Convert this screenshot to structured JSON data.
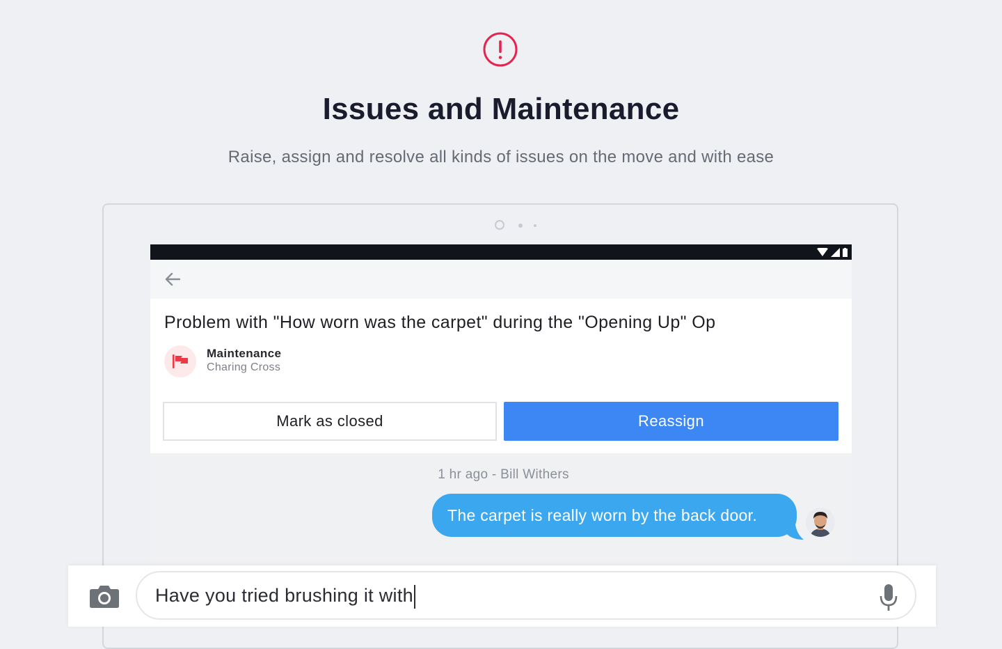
{
  "hero": {
    "title": "Issues and Maintenance",
    "subtitle": "Raise, assign and resolve all kinds of issues on the move and with ease",
    "icon": "alert-circle-icon",
    "accent_color": "#e5244f"
  },
  "issue": {
    "title": "Problem with \"How worn was the carpet\" during the \"Opening Up\" Op",
    "category": "Maintenance",
    "location": "Charing Cross",
    "icon": "flag-icon",
    "icon_color": "#ea3a45"
  },
  "actions": {
    "close_label": "Mark as closed",
    "reassign_label": "Reassign",
    "primary_color": "#3d87f5"
  },
  "conversation": {
    "meta": "1 hr ago - Bill Withers",
    "message": "The carpet is really worn by the back door.",
    "bubble_color": "#3aa7ee"
  },
  "composer": {
    "value": "Have you tried brushing it with",
    "camera_icon": "camera-icon",
    "mic_icon": "microphone-icon"
  }
}
